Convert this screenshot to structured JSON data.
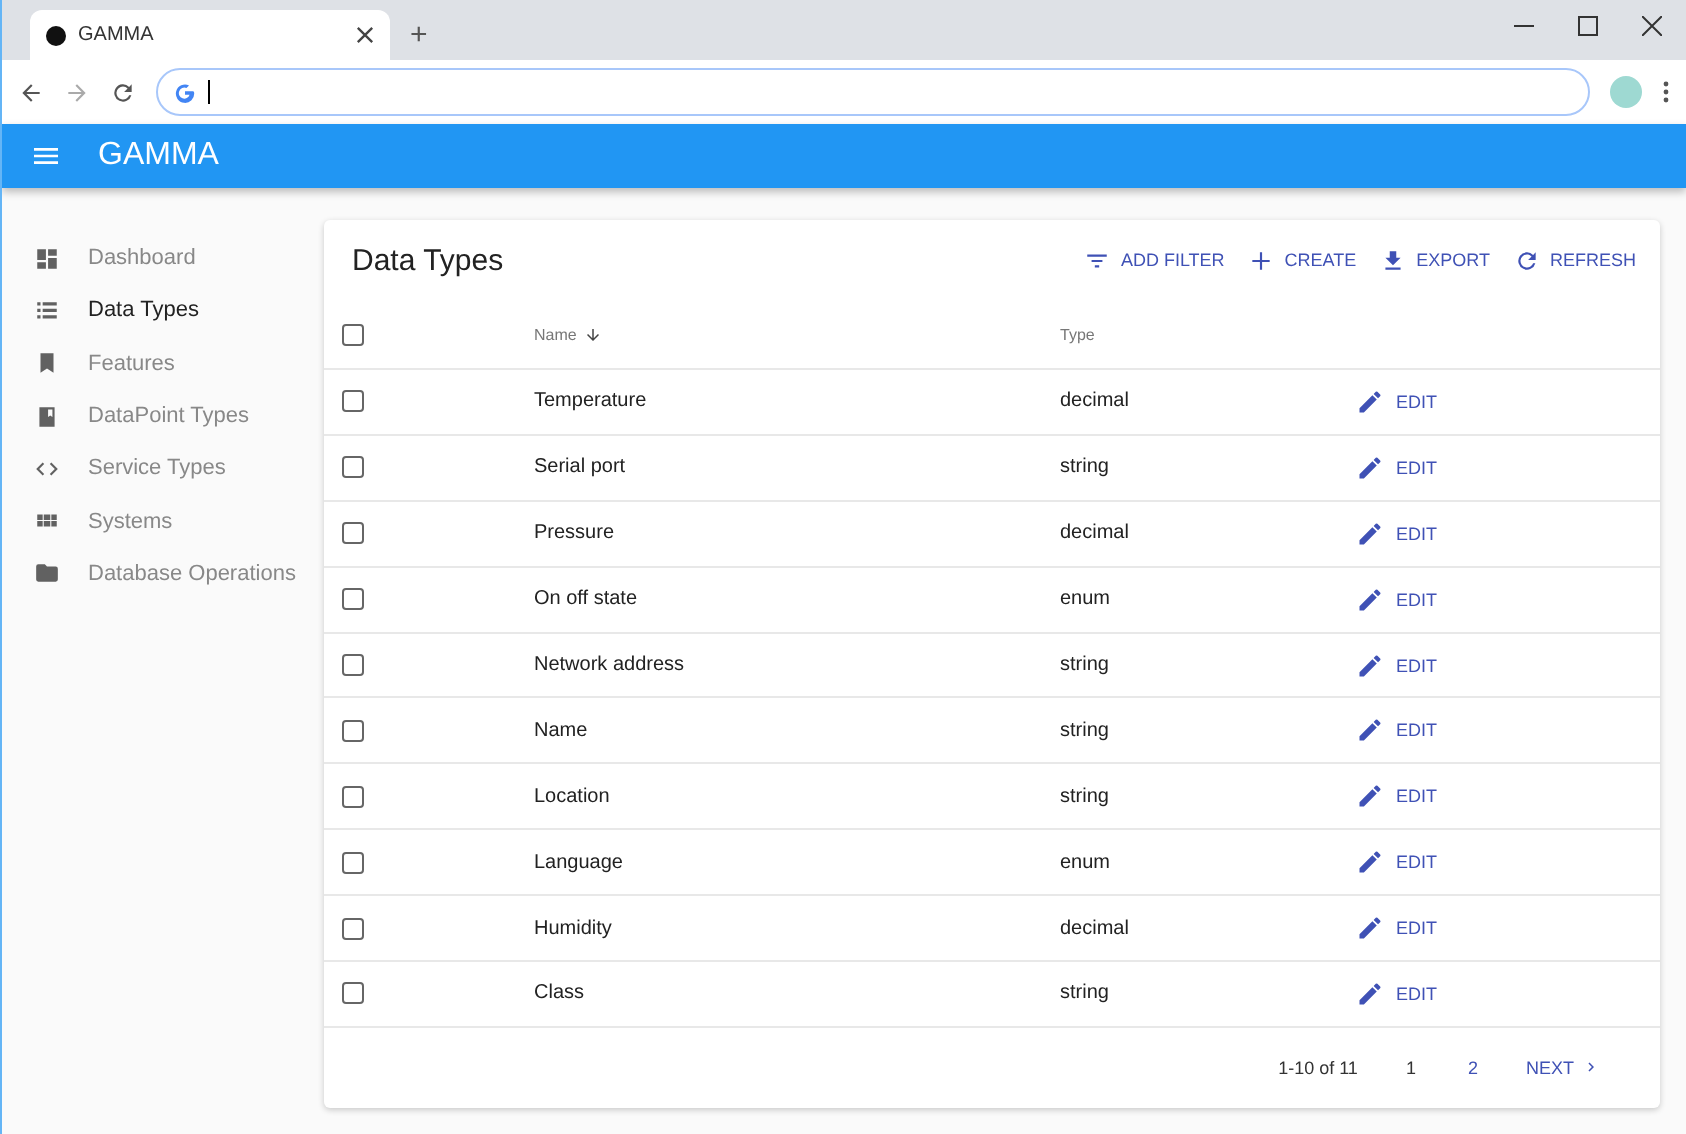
{
  "browser": {
    "tab_title": "GAMMA",
    "new_tab": "+"
  },
  "app_bar": {
    "title": "GAMMA"
  },
  "sidebar": {
    "items": [
      {
        "label": "Dashboard",
        "selected": false
      },
      {
        "label": "Data Types",
        "selected": true
      },
      {
        "label": "Features",
        "selected": false
      },
      {
        "label": "DataPoint Types",
        "selected": false
      },
      {
        "label": "Service Types",
        "selected": false
      },
      {
        "label": "Systems",
        "selected": false
      },
      {
        "label": "Database Operations",
        "selected": false
      }
    ]
  },
  "card": {
    "title": "Data Types",
    "actions": [
      {
        "label": "ADD FILTER"
      },
      {
        "label": "CREATE"
      },
      {
        "label": "EXPORT"
      },
      {
        "label": "REFRESH"
      }
    ],
    "table": {
      "select_all_checked": false,
      "columns": [
        "Name",
        "Type"
      ],
      "rows": [
        {
          "name": "Temperature",
          "type": "decimal",
          "checked": false,
          "action": "EDIT"
        },
        {
          "name": "Serial port",
          "type": "string",
          "checked": false,
          "action": "EDIT"
        },
        {
          "name": "Pressure",
          "type": "decimal",
          "checked": false,
          "action": "EDIT"
        },
        {
          "name": "On off state",
          "type": "enum",
          "checked": false,
          "action": "EDIT"
        },
        {
          "name": "Network address",
          "type": "string",
          "checked": false,
          "action": "EDIT"
        },
        {
          "name": "Name",
          "type": "string",
          "checked": false,
          "action": "EDIT"
        },
        {
          "name": "Location",
          "type": "string",
          "checked": false,
          "action": "EDIT"
        },
        {
          "name": "Language",
          "type": "enum",
          "checked": false,
          "action": "EDIT"
        },
        {
          "name": "Humidity",
          "type": "decimal",
          "checked": false,
          "action": "EDIT"
        },
        {
          "name": "Class",
          "type": "string",
          "checked": false,
          "action": "EDIT"
        }
      ]
    },
    "pagination": {
      "range": "1-10 of 11",
      "pages": [
        {
          "label": "1",
          "selected": true
        },
        {
          "label": "2",
          "selected": false
        }
      ],
      "next": "NEXT"
    }
  }
}
